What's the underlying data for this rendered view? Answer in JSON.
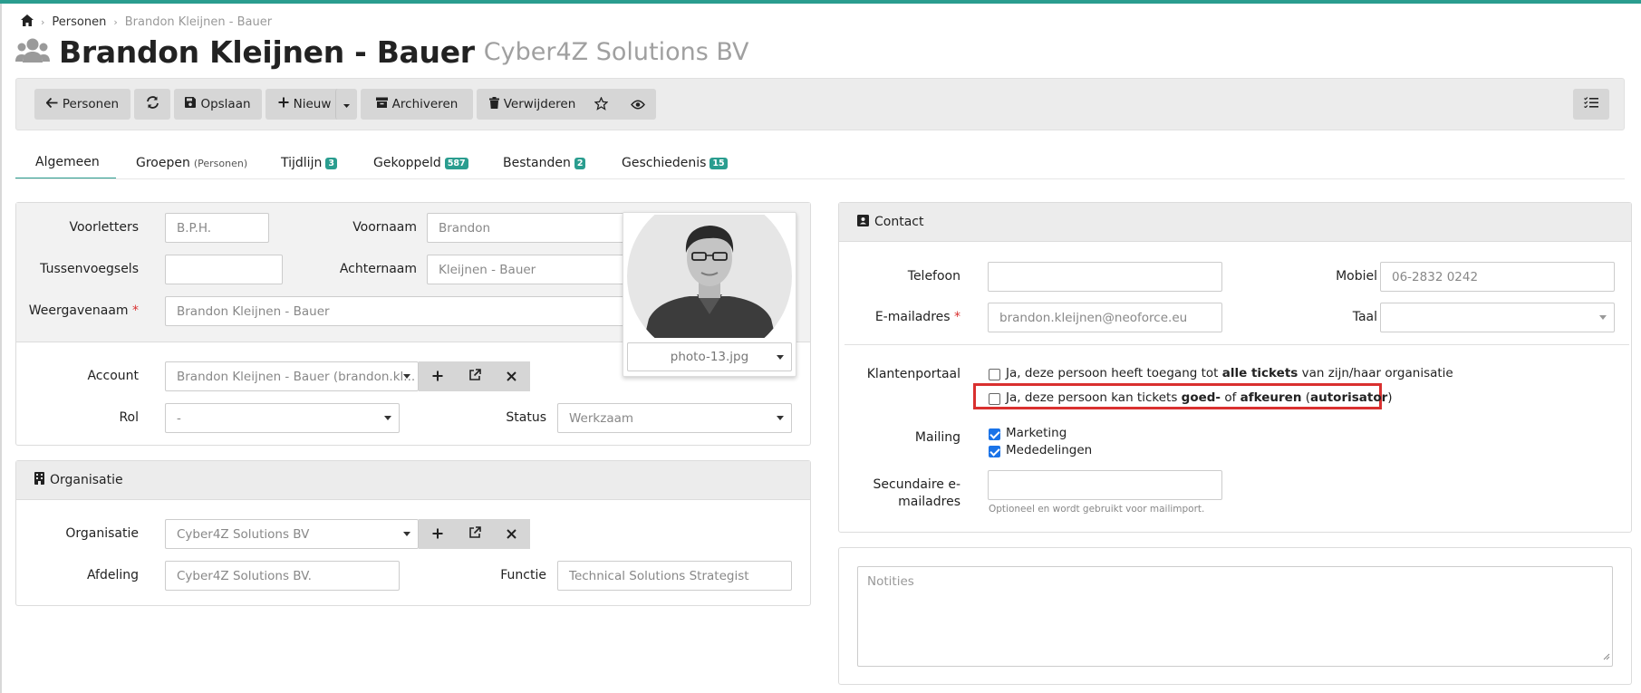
{
  "breadcrumb": {
    "home_icon": "home-icon",
    "items": [
      "Personen",
      "Brandon Kleijnen - Bauer"
    ]
  },
  "header": {
    "title": "Brandon Kleijnen - Bauer",
    "subtitle": "Cyber4Z Solutions BV",
    "icon": "users-icon"
  },
  "toolbar": {
    "back_label": "Personen",
    "save_label": "Opslaan",
    "new_label": "Nieuw",
    "archive_label": "Archiveren",
    "delete_label": "Verwijderen"
  },
  "tabs": [
    {
      "label": "Algemeen"
    },
    {
      "label": "Groepen",
      "extra": "(Personen)"
    },
    {
      "label": "Tijdlijn",
      "badge": "3"
    },
    {
      "label": "Gekoppeld",
      "badge": "587"
    },
    {
      "label": "Bestanden",
      "badge": "2"
    },
    {
      "label": "Geschiedenis",
      "badge": "15"
    }
  ],
  "person": {
    "voorletters_label": "Voorletters",
    "voorletters_value": "B.P.H.",
    "voornaam_label": "Voornaam",
    "voornaam_value": "Brandon",
    "tussenvoegsels_label": "Tussenvoegsels",
    "tussenvoegsels_value": "",
    "achternaam_label": "Achternaam",
    "achternaam_value": "Kleijnen - Bauer",
    "weergavenaam_label": "Weergavenaam",
    "weergavenaam_value": "Brandon Kleijnen - Bauer",
    "photo_file": "photo-13.jpg",
    "account_label": "Account",
    "account_value": "Brandon Kleijnen - Bauer (brandon.kl...",
    "rol_label": "Rol",
    "rol_value": "-",
    "status_label": "Status",
    "status_value": "Werkzaam"
  },
  "organisation": {
    "heading": "Organisatie",
    "org_label": "Organisatie",
    "org_value": "Cyber4Z Solutions BV",
    "afdeling_label": "Afdeling",
    "afdeling_value": "Cyber4Z Solutions BV.",
    "functie_label": "Functie",
    "functie_value": "Technical Solutions Strategist"
  },
  "contact": {
    "heading": "Contact",
    "telefoon_label": "Telefoon",
    "telefoon_value": "",
    "mobiel_label": "Mobiel",
    "mobiel_value": "06-2832 0242",
    "email_label": "E-mailadres",
    "email_value": "brandon.kleijnen@neoforce.eu",
    "taal_label": "Taal",
    "taal_value": "",
    "portal_label": "Klantenportaal",
    "portal_opt1_a": "Ja, deze persoon heeft toegang tot ",
    "portal_opt1_b": "alle tickets",
    "portal_opt1_c": " van zijn/haar organisatie",
    "portal_opt2_a": "Ja, deze persoon kan tickets ",
    "portal_opt2_b": "goed-",
    "portal_opt2_c": " of ",
    "portal_opt2_d": "afkeuren",
    "portal_opt2_e": " (",
    "portal_opt2_f": "autorisator",
    "portal_opt2_g": ")",
    "mailing_label": "Mailing",
    "mailing_opt1": "Marketing",
    "mailing_opt2": "Mededelingen",
    "secondary_label_1": "Secundaire e-",
    "secondary_label_2": "mailadres",
    "secondary_hint": "Optioneel en wordt gebruikt voor mailimport.",
    "notes_placeholder": "Notities"
  },
  "colors": {
    "accent": "#2a9d8f",
    "highlight": "#d9302f",
    "check": "#1a73e8"
  }
}
